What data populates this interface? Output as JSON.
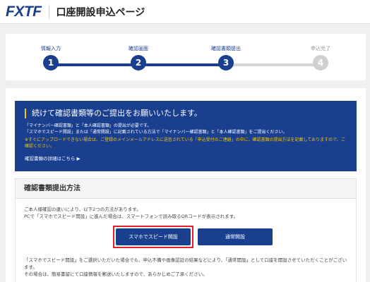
{
  "header": {
    "logo_text": "FXTF",
    "title": "口座開設申込ページ"
  },
  "stepper": {
    "steps": [
      {
        "label": "情報入力",
        "number": "1",
        "state": "done"
      },
      {
        "label": "確認画面",
        "number": "2",
        "state": "done"
      },
      {
        "label": "確認書類提出",
        "number": "3",
        "state": "current"
      },
      {
        "label": "申込完了",
        "number": "4",
        "state": "inactive"
      }
    ]
  },
  "notice": {
    "title": "続けて確認書類等のご提出をお願いいたします。",
    "line1": "「マイナンバー確認書類」と「本人確認書類」の提出が必要です。",
    "line2": "「スマホでスピード開設」または「通常開設」に記載されている方法で「マイナンバー確認書類」と「本人確認書類」をご提出ください。",
    "warn": "※すぐにアップロードできない場合は、ご登録のメインメールアドレスに送信されている「申込受付のご連絡」の中に、確認書類の提出方法を記載しておりますので、ご確認ください。",
    "more_link": "確認書類の詳細はこちら ▶"
  },
  "method": {
    "heading": "確認書類提出方法",
    "intro1": "ご本人様確認の違いにより、以下2つの方法があります。",
    "intro2": "PCで「スマホでスピード開設」に進んだ場合は、スマートフォンで読み取るQRコードが表示されます。",
    "speed_button": "スマホでスピード開設",
    "normal_button": "通常開設",
    "note1": "「スマホでスピード開設」をご選択いただいた場合でも、申込不備や画像認証の結果などにより、「通常開設」として口座を開設させていただくことがございます。",
    "note2": "その場合は、簡易書留にて口座情報を郵送いたしますので、あらかじめご了承ください。"
  },
  "colors": {
    "brand": "#1a3f8f",
    "accent_yellow": "#f0c419",
    "highlight_red": "#e0202a"
  }
}
